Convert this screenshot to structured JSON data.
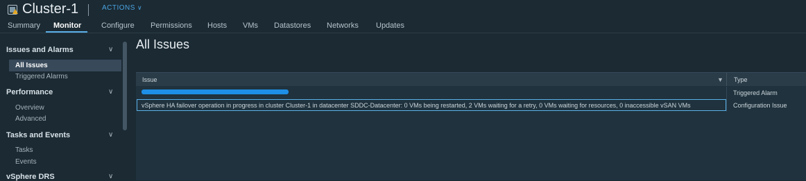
{
  "header": {
    "title": "Cluster-1",
    "actions_label": "ACTIONS",
    "tabs": [
      {
        "label": "Summary"
      },
      {
        "label": "Monitor"
      },
      {
        "label": "Configure"
      },
      {
        "label": "Permissions"
      },
      {
        "label": "Hosts"
      },
      {
        "label": "VMs"
      },
      {
        "label": "Datastores"
      },
      {
        "label": "Networks"
      },
      {
        "label": "Updates"
      }
    ],
    "active_tab": "Monitor"
  },
  "sidebar": {
    "groups": [
      {
        "label": "Issues and Alarms",
        "items": [
          "All Issues",
          "Triggered Alarms"
        ]
      },
      {
        "label": "Performance",
        "items": [
          "Overview",
          "Advanced"
        ]
      },
      {
        "label": "Tasks and Events",
        "items": [
          "Tasks",
          "Events"
        ]
      },
      {
        "label": "vSphere DRS",
        "items": []
      }
    ],
    "selected_item": "All Issues"
  },
  "main": {
    "title": "All Issues",
    "columns": [
      "Issue",
      "Type"
    ],
    "rows": [
      {
        "issue": "",
        "type": "Triggered Alarm"
      },
      {
        "issue": "vSphere HA failover operation in progress in cluster Cluster-1 in datacenter SDDC-Datacenter: 0 VMs being restarted, 2 VMs waiting for a retry, 0 VMs waiting for resources, 0 inaccessible vSAN VMs",
        "type": "Configuration Issue"
      }
    ]
  },
  "colors": {
    "background": "#1b2a33",
    "accent": "#5ab0e8",
    "actions_link": "#4aa3df",
    "redaction": "#1e8fe6"
  }
}
